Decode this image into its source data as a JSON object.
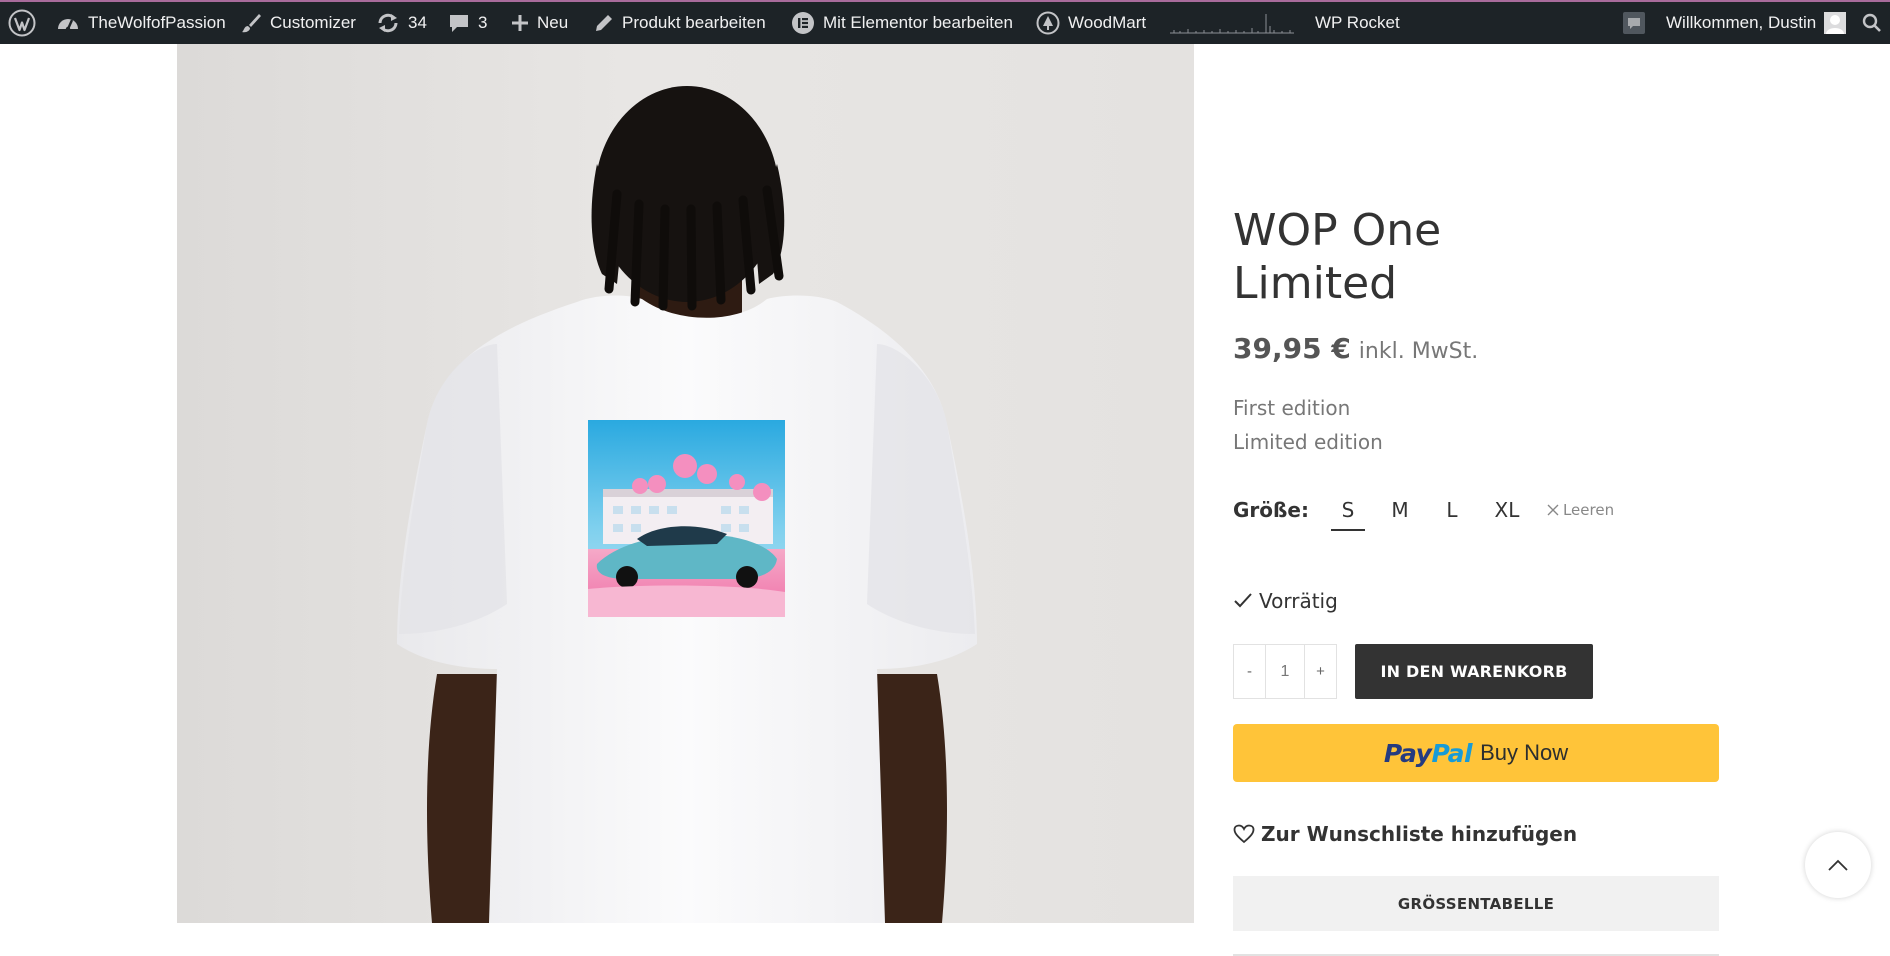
{
  "admin_bar": {
    "site_name": "TheWolfofPassion",
    "customizer": "Customizer",
    "updates_count": "34",
    "comments_count": "3",
    "new": "Neu",
    "edit_product": "Produkt bearbeiten",
    "elementor": "Mit Elementor bearbeiten",
    "woodmart": "WoodMart",
    "wp_rocket": "WP Rocket",
    "welcome": "Willkommen, Dustin"
  },
  "product": {
    "title_line1": "WOP One",
    "title_line2": "Limited",
    "price": "39,95 €",
    "tax_note": "inkl. MwSt.",
    "description": [
      "First edition",
      "Limited edition"
    ],
    "size_label": "Größe:",
    "sizes": [
      "S",
      "M",
      "L",
      "XL"
    ],
    "selected_size": "S",
    "reset_label": "Leeren",
    "stock_status": "Vorrätig",
    "quantity": "1",
    "qty_minus": "-",
    "qty_plus": "+",
    "add_to_cart": "IN DEN WARENKORB",
    "paypal_pay1": "Pay",
    "paypal_pay2": "Pal",
    "paypal_buy_now": "Buy Now",
    "wishlist": "Zur Wunschliste hinzufügen",
    "size_chart": "GRÖSSENTABELLE"
  },
  "colors": {
    "admin_bar_bg": "#1d2327",
    "add_to_cart_bg": "#333333",
    "paypal_yellow": "#ffc439",
    "paypal_dark_blue": "#253b80",
    "paypal_light_blue": "#179bd7"
  }
}
